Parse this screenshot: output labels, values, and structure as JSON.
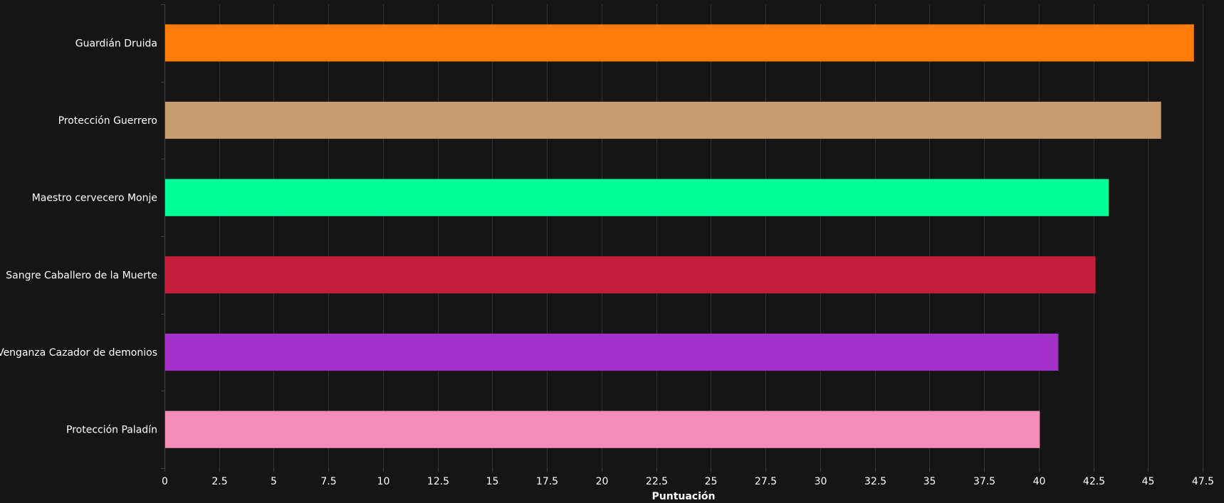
{
  "chart_data": {
    "type": "bar",
    "orientation": "horizontal",
    "categories": [
      "Guardián Druida",
      "Protección Guerrero",
      "Maestro cervecero Monje",
      "Sangre Caballero de la Muerte",
      "Venganza Cazador de demonios",
      "Protección Paladín"
    ],
    "values": [
      47.1,
      45.6,
      43.2,
      42.6,
      40.9,
      40.05
    ],
    "colors": [
      "#FF7C0A",
      "#C69B6D",
      "#00FF98",
      "#C41E3A",
      "#A330C9",
      "#F48CBA"
    ],
    "xlabel": "Puntuación",
    "ylabel": "",
    "xlim": [
      0,
      47.5
    ],
    "xticks": [
      0,
      2.5,
      5,
      7.5,
      10,
      12.5,
      15,
      17.5,
      20,
      22.5,
      25,
      27.5,
      30,
      32.5,
      35,
      37.5,
      40,
      42.5,
      45,
      47.5
    ],
    "xtick_labels": [
      "0",
      "2.5",
      "5",
      "7.5",
      "10",
      "12.5",
      "15",
      "17.5",
      "20",
      "22.5",
      "25",
      "27.5",
      "30",
      "32.5",
      "35",
      "37.5",
      "40",
      "42.5",
      "45",
      "47.5"
    ],
    "grid": true,
    "background": "#151515"
  }
}
